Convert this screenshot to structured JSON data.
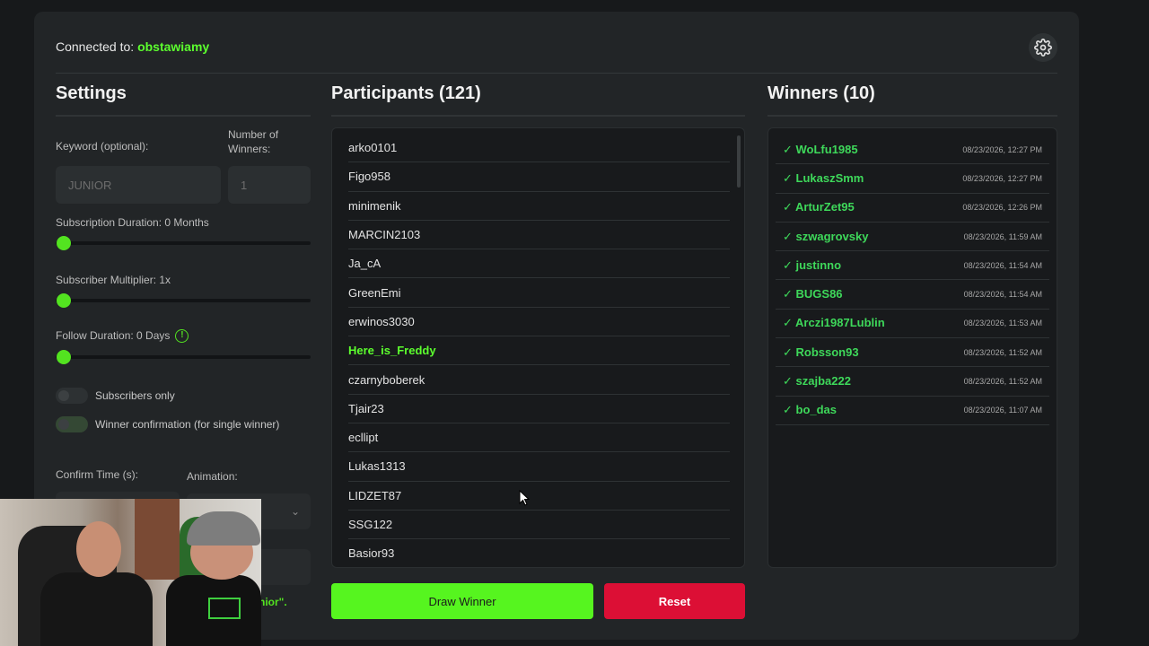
{
  "header": {
    "connected_label": "Connected to:",
    "channel": "obstawiamy"
  },
  "settings": {
    "title": "Settings",
    "keyword_label": "Keyword (optional):",
    "keyword_value": "JUNIOR",
    "winners_count_label": "Number of Winners:",
    "winners_count_value": "1",
    "sub_duration_label": "Subscription Duration: 0 Months",
    "sub_multiplier_label": "Subscriber Multiplier: 1x",
    "follow_duration_label": "Follow Duration:  0  Days",
    "info_glyph": "!",
    "subscribers_only_label": "Subscribers only",
    "winner_confirm_label": "Winner confirmation (for single winner)",
    "confirm_time_label": "Confirm Time (s):",
    "animation_label": "Animation:",
    "chevron_glyph": "⌄",
    "note_fragment": "nior\"."
  },
  "participants": {
    "title": "Participants (121)",
    "items": [
      "arko0101",
      "Figo958",
      "minimenik",
      "MARCIN2103",
      "Ja_cA",
      "GreenEmi",
      "erwinos3030",
      "Here_is_Freddy",
      "czarnyboberek",
      "Tjair23",
      "ecllipt",
      "Lukas1313",
      "LIDZET87",
      "SSG122",
      "Basior93"
    ],
    "highlighted_index": 7
  },
  "actions": {
    "draw_label": "Draw Winner",
    "reset_label": "Reset"
  },
  "winners": {
    "title": "Winners (10)",
    "items": [
      {
        "name": "✓ WoLfu1985",
        "time": "08/23/2026, 12:27 PM"
      },
      {
        "name": "✓ LukaszSmm",
        "time": "08/23/2026, 12:27 PM"
      },
      {
        "name": "✓ ArturZet95",
        "time": "08/23/2026, 12:26 PM"
      },
      {
        "name": "✓ szwagrovsky",
        "time": "08/23/2026, 11:59 AM"
      },
      {
        "name": "✓ justinno",
        "time": "08/23/2026, 11:54 AM"
      },
      {
        "name": "✓ BUGS86",
        "time": "08/23/2026, 11:54 AM"
      },
      {
        "name": "✓ Arczi1987Lublin",
        "time": "08/23/2026, 11:53 AM"
      },
      {
        "name": "✓ Robsson93",
        "time": "08/23/2026, 11:52 AM"
      },
      {
        "name": "✓ szajba222",
        "time": "08/23/2026, 11:52 AM"
      },
      {
        "name": "✓ bo_das",
        "time": "08/23/2026, 11:07 AM"
      }
    ]
  },
  "colors": {
    "accent": "#56f51f",
    "danger": "#dc0f35",
    "panel": "#222527"
  },
  "icons": {
    "settings": "gear-icon",
    "cursor": "mouse-pointer-icon"
  }
}
